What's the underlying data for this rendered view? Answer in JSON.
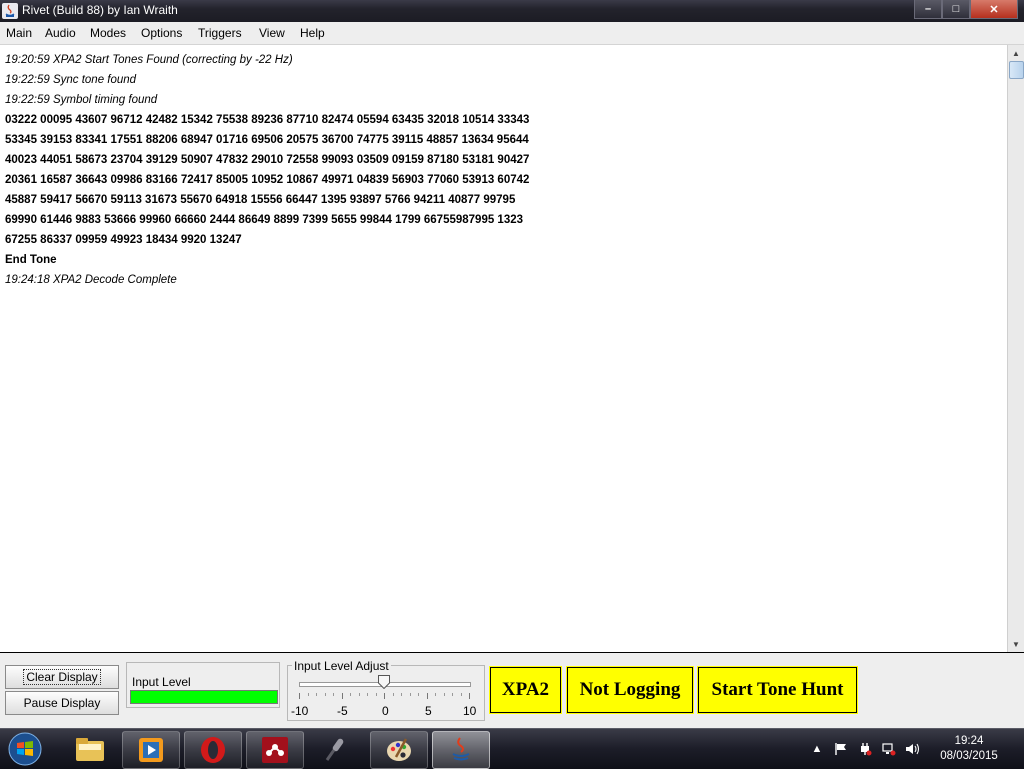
{
  "window": {
    "title": "Rivet (Build 88) by Ian Wraith",
    "controls": {
      "minimize": "–",
      "maximize": "□",
      "close": "✕"
    }
  },
  "menu": [
    "Main",
    "Audio",
    "Modes",
    "Options",
    "Triggers",
    "View",
    "Help"
  ],
  "log": [
    "19:20:59 XPA2 Start Tones Found (correcting by -22 Hz)",
    "19:22:59 Sync tone found",
    "19:22:59 Symbol timing found",
    "03222 00095 43607 96712 42482 15342 75538 89236 87710 82474 05594 63435 32018 10514 33343",
    "53345 39153 83341 17551 88206 68947 01716 69506 20575 36700 74775 39115 48857 13634 95644",
    "40023 44051 58673 23704 39129 50907 47832 29010 72558 99093 03509 09159 87180 53181 90427",
    "20361 16587 36643 09986 83166 72417 85005 10952 10867 49971 04839 56903 77060 53913 60742",
    "45887 59417 56670 59113 31673 55670 64918 15556 66447 1395 93897 5766 94211 40877 99795",
    "69990 61446 9883 53666 99960 66660 2444 86649 8899 7399 5655 99844 1799 66755987995 1323",
    "67255 86337 09959 49923 18434 9920 13247",
    "End Tone",
    "19:24:18 XPA2 Decode Complete"
  ],
  "controls": {
    "clear_display": "Clear Display",
    "pause_display": "Pause Display",
    "input_level_label": "Input Level",
    "input_level_value": 1.0,
    "input_level_color": "#00ff00",
    "adjust_label": "Input Level Adjust",
    "adjust_ticks": [
      "-10",
      "-5",
      "0",
      "5",
      "10"
    ],
    "adjust_value": 0,
    "mode_button": "XPA2",
    "logging_button": "Not Logging",
    "tone_hunt_button": "Start Tone Hunt",
    "button_color": "#ffff00"
  },
  "taskbar": {
    "apps": [
      "file-explorer-icon",
      "media-player-icon",
      "opera-icon",
      "mendeley-icon",
      "microphone-icon",
      "paint-icon",
      "java-icon"
    ],
    "clock_time": "19:24",
    "clock_date": "08/03/2015"
  }
}
